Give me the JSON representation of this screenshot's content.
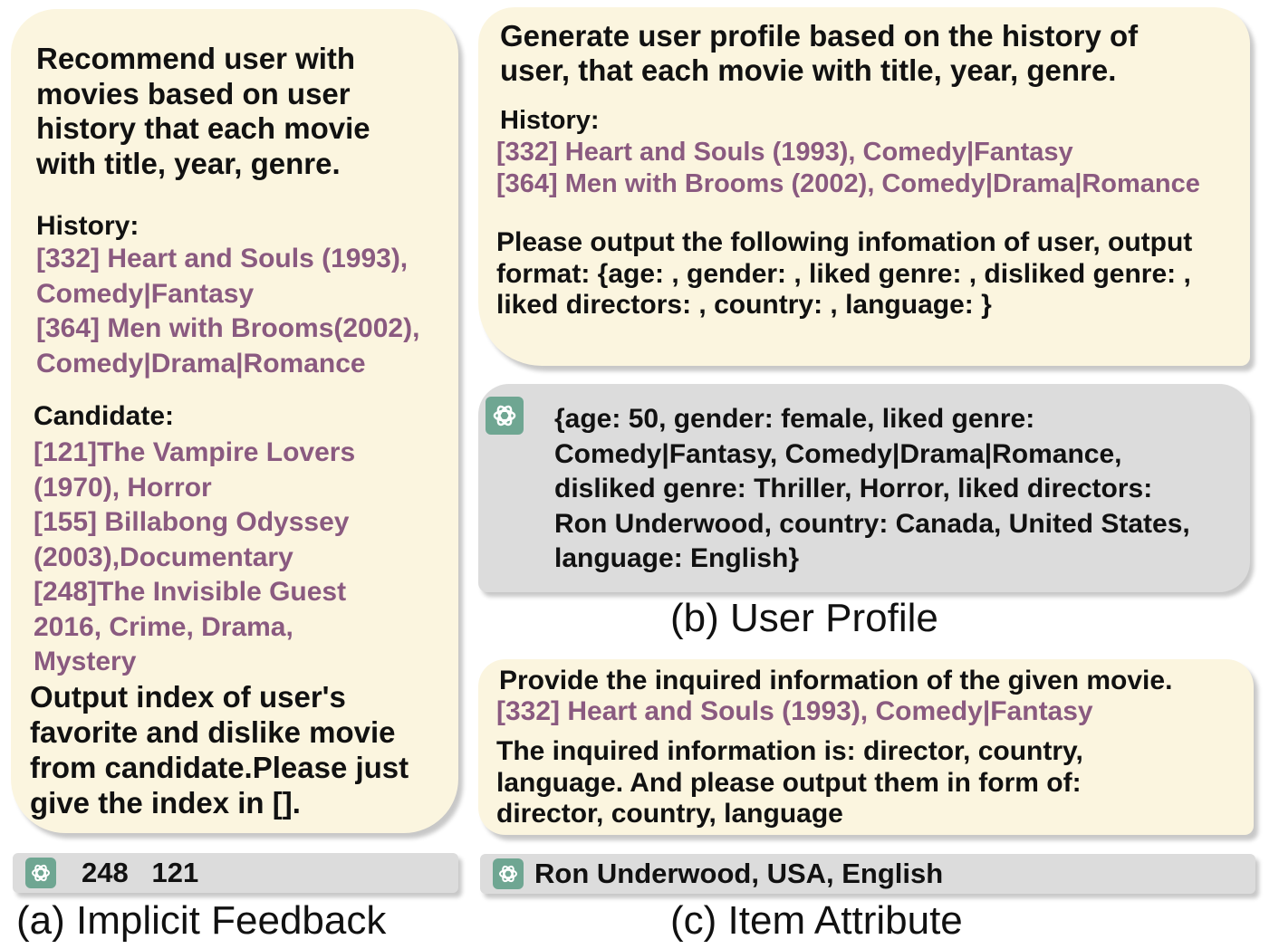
{
  "panel_a": {
    "instruction": [
      "Recommend user with",
      "movies based on user",
      "history  that each movie",
      "with title, year, genre."
    ],
    "history_label": "History:",
    "history_items": [
      "[332] Heart and Souls (1993),",
      "Comedy|Fantasy",
      "[364] Men with Brooms(2002),",
      "Comedy|Drama|Romance"
    ],
    "candidate_label": "Candidate:",
    "candidate_items": [
      "[121]The Vampire Lovers",
      "(1970), Horror",
      "[155] Billabong Odyssey",
      "(2003),Documentary",
      "[248]The Invisible Guest",
      "2016, Crime, Drama,",
      "Mystery"
    ],
    "output_instruction": [
      "Output index of user's",
      "favorite and dislike movie",
      "from candidate.Please just",
      "give the index in []."
    ],
    "response": "248   121",
    "caption": "(a)  Implicit Feedback"
  },
  "panel_b": {
    "instruction": [
      "Generate user profile based on the history of",
      "user, that each movie with title, year, genre."
    ],
    "history_label": "History:",
    "history_items": [
      "[332] Heart and Souls (1993), Comedy|Fantasy",
      "[364] Men with Brooms (2002), Comedy|Drama|Romance"
    ],
    "output_instruction": [
      "Please output the following infomation of user, output",
      "format: {age: , gender: , liked genre: , disliked genre: ,",
      "liked directors: , country: , language: }"
    ],
    "response": [
      "{age: 50, gender: female, liked genre:",
      "Comedy|Fantasy, Comedy|Drama|Romance,",
      "disliked genre: Thriller, Horror, liked directors:",
      "Ron Underwood, country: Canada, United States,",
      "language: English}"
    ],
    "caption": "(b)  User Profile"
  },
  "panel_c": {
    "instruction": "Provide the inquired information of the given movie.",
    "movie": "[332] Heart and Souls (1993), Comedy|Fantasy",
    "output_instruction": [
      "The inquired information is: director, country,",
      "language. And please output them in form of:",
      "director, country, language"
    ],
    "response": "Ron Underwood, USA, English",
    "caption": "(c)  Item Attribute"
  },
  "icon": "chatgpt-logo-icon",
  "colors": {
    "prompt_bg": "#fbf5df",
    "response_bg": "#dcdcdc",
    "highlight_text": "#8a5a80",
    "icon_bg": "#6fa692"
  }
}
